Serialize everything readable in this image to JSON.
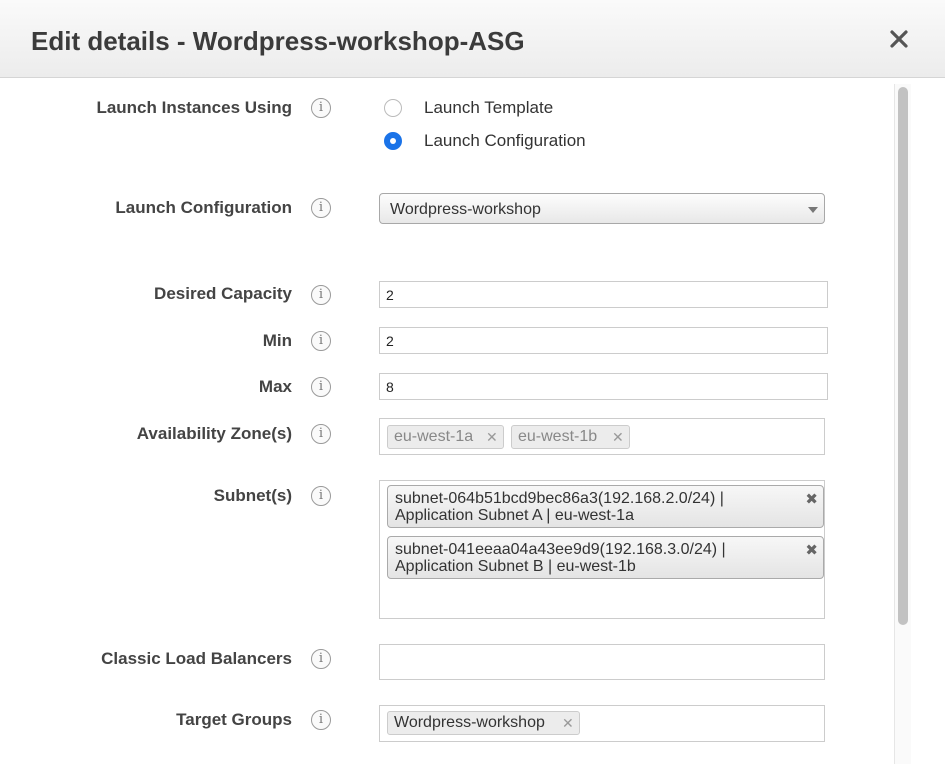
{
  "dialog": {
    "title": "Edit details - Wordpress-workshop-ASG",
    "close_glyph": "×"
  },
  "info_glyph": "i",
  "fields": {
    "launch_using": {
      "label": "Launch Instances Using",
      "options": [
        {
          "label": "Launch Template",
          "selected": false
        },
        {
          "label": "Launch Configuration",
          "selected": true
        }
      ]
    },
    "launch_configuration": {
      "label": "Launch Configuration",
      "value": "Wordpress-workshop"
    },
    "desired_capacity": {
      "label": "Desired Capacity",
      "value": "2"
    },
    "min": {
      "label": "Min",
      "value": "2"
    },
    "max": {
      "label": "Max",
      "value": "8"
    },
    "availability_zones": {
      "label": "Availability Zone(s)",
      "chips": [
        {
          "text": "eu-west-1a"
        },
        {
          "text": "eu-west-1b"
        }
      ]
    },
    "subnets": {
      "label": "Subnet(s)",
      "chips": [
        {
          "line1": "subnet-064b51bcd9bec86a3(192.168.2.0/24) |",
          "line2": "Application Subnet A | eu-west-1a"
        },
        {
          "line1": "subnet-041eeaa04a43ee9d9(192.168.3.0/24) |",
          "line2": "Application Subnet B | eu-west-1b"
        }
      ]
    },
    "classic_load_balancers": {
      "label": "Classic Load Balancers",
      "value": ""
    },
    "target_groups": {
      "label": "Target Groups",
      "chips": [
        {
          "text": "Wordpress-workshop"
        }
      ]
    }
  },
  "chip_remove_glyph": "✕",
  "subnet_remove_glyph": "✖",
  "colors": {
    "radio_selected": "#1a73e8",
    "header_bg": "#f2f2f2"
  }
}
